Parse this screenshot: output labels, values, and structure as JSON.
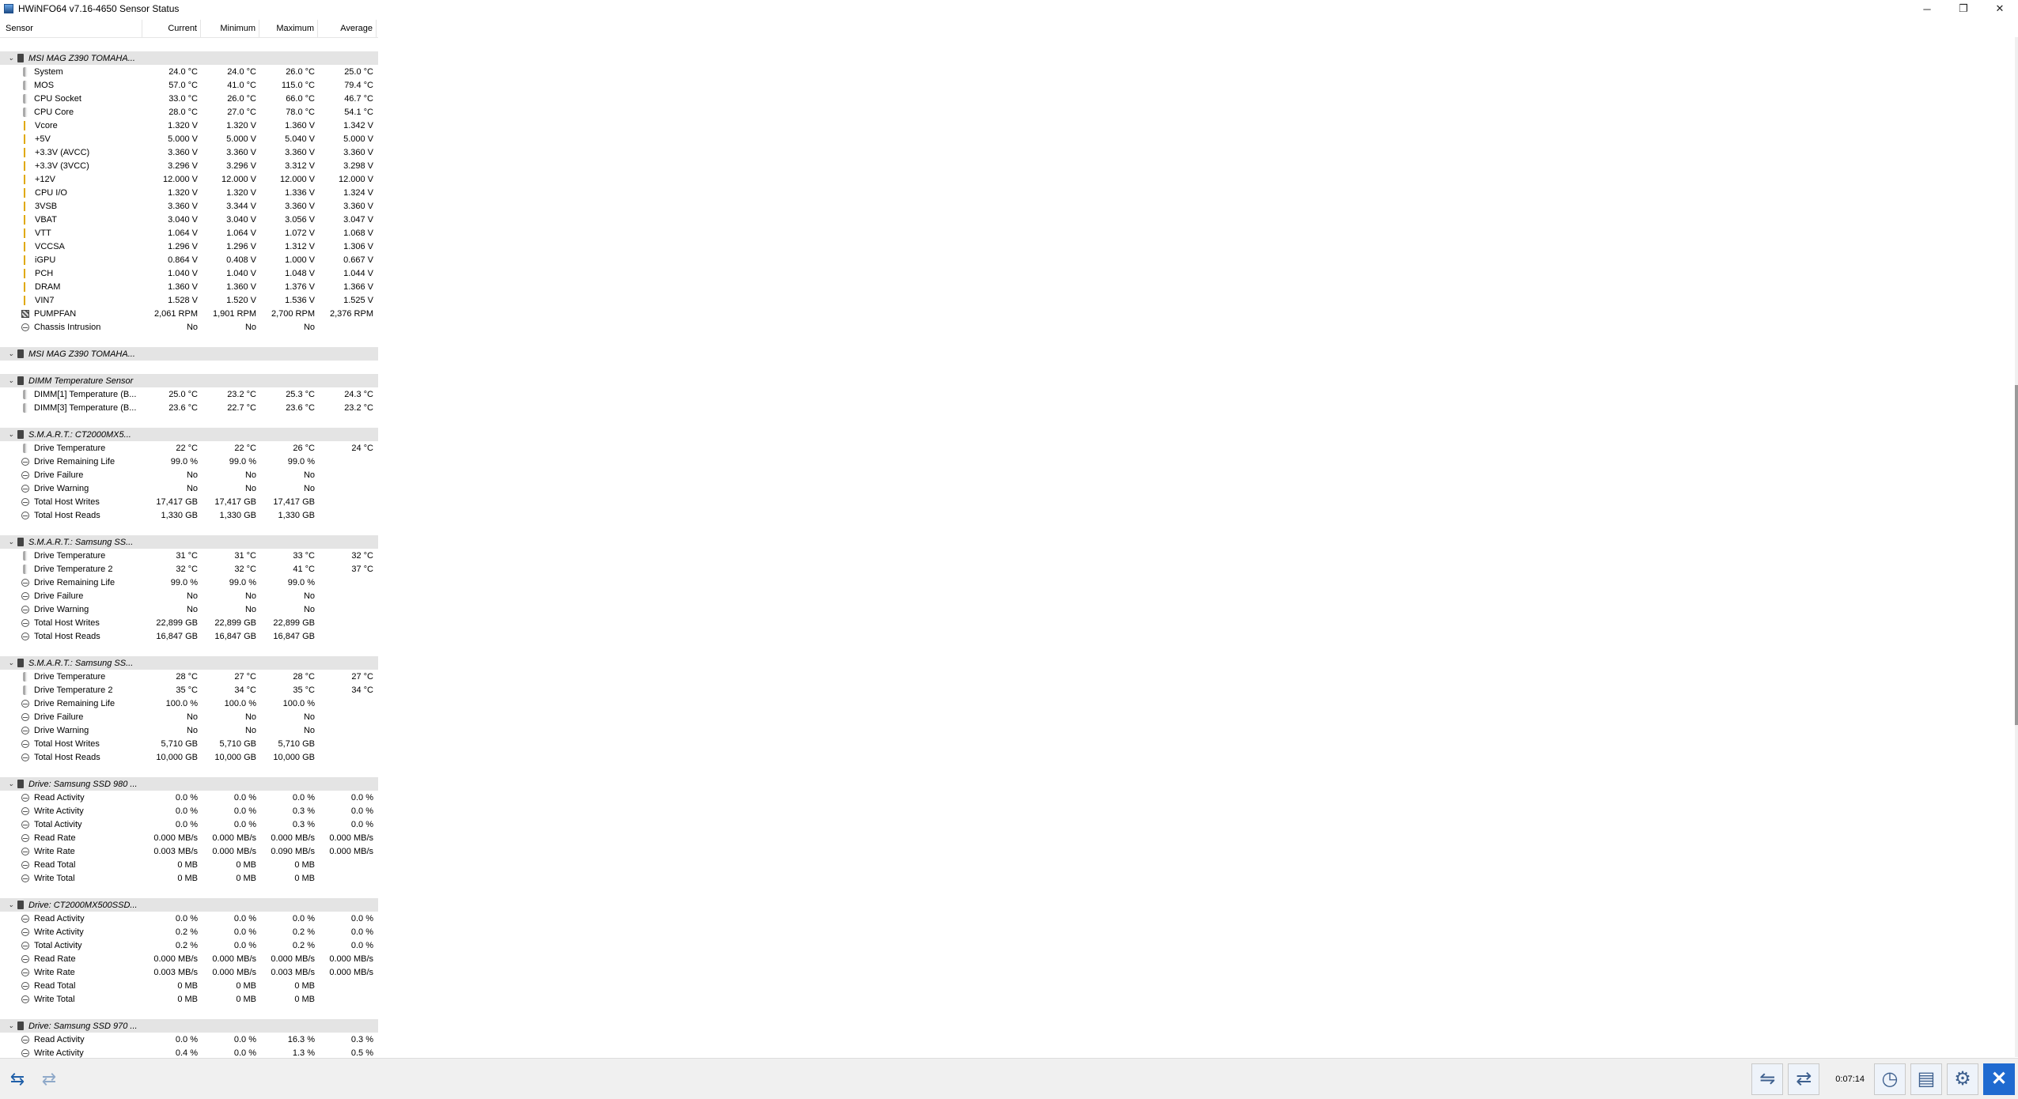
{
  "window": {
    "title": "HWiNFO64 v7.16-4650 Sensor Status",
    "minimize": "─",
    "maximize": "❐",
    "close": "✕"
  },
  "columns": [
    "Sensor",
    "Current",
    "Minimum",
    "Maximum",
    "Average"
  ],
  "rows": [
    {
      "type": "empty"
    },
    {
      "type": "group",
      "name": "MSI MAG Z390 TOMAHA..."
    },
    {
      "type": "sensor",
      "icon": "therm",
      "name": "System",
      "v": [
        "24.0 °C",
        "24.0 °C",
        "26.0 °C",
        "25.0 °C"
      ]
    },
    {
      "type": "sensor",
      "icon": "therm",
      "name": "MOS",
      "v": [
        "57.0 °C",
        "41.0 °C",
        "115.0 °C",
        "79.4 °C"
      ]
    },
    {
      "type": "sensor",
      "icon": "therm",
      "name": "CPU Socket",
      "v": [
        "33.0 °C",
        "26.0 °C",
        "66.0 °C",
        "46.7 °C"
      ]
    },
    {
      "type": "sensor",
      "icon": "therm",
      "name": "CPU Core",
      "v": [
        "28.0 °C",
        "27.0 °C",
        "78.0 °C",
        "54.1 °C"
      ]
    },
    {
      "type": "sensor",
      "icon": "volt",
      "name": "Vcore",
      "v": [
        "1.320 V",
        "1.320 V",
        "1.360 V",
        "1.342 V"
      ]
    },
    {
      "type": "sensor",
      "icon": "volt",
      "name": "+5V",
      "v": [
        "5.000 V",
        "5.000 V",
        "5.040 V",
        "5.000 V"
      ]
    },
    {
      "type": "sensor",
      "icon": "volt",
      "name": "+3.3V (AVCC)",
      "v": [
        "3.360 V",
        "3.360 V",
        "3.360 V",
        "3.360 V"
      ]
    },
    {
      "type": "sensor",
      "icon": "volt",
      "name": "+3.3V (3VCC)",
      "v": [
        "3.296 V",
        "3.296 V",
        "3.312 V",
        "3.298 V"
      ]
    },
    {
      "type": "sensor",
      "icon": "volt",
      "name": "+12V",
      "v": [
        "12.000 V",
        "12.000 V",
        "12.000 V",
        "12.000 V"
      ]
    },
    {
      "type": "sensor",
      "icon": "volt",
      "name": "CPU I/O",
      "v": [
        "1.320 V",
        "1.320 V",
        "1.336 V",
        "1.324 V"
      ]
    },
    {
      "type": "sensor",
      "icon": "volt",
      "name": "3VSB",
      "v": [
        "3.360 V",
        "3.344 V",
        "3.360 V",
        "3.360 V"
      ]
    },
    {
      "type": "sensor",
      "icon": "volt",
      "name": "VBAT",
      "v": [
        "3.040 V",
        "3.040 V",
        "3.056 V",
        "3.047 V"
      ]
    },
    {
      "type": "sensor",
      "icon": "volt",
      "name": "VTT",
      "v": [
        "1.064 V",
        "1.064 V",
        "1.072 V",
        "1.068 V"
      ]
    },
    {
      "type": "sensor",
      "icon": "volt",
      "name": "VCCSA",
      "v": [
        "1.296 V",
        "1.296 V",
        "1.312 V",
        "1.306 V"
      ]
    },
    {
      "type": "sensor",
      "icon": "volt",
      "name": "iGPU",
      "v": [
        "0.864 V",
        "0.408 V",
        "1.000 V",
        "0.667 V"
      ]
    },
    {
      "type": "sensor",
      "icon": "volt",
      "name": "PCH",
      "v": [
        "1.040 V",
        "1.040 V",
        "1.048 V",
        "1.044 V"
      ]
    },
    {
      "type": "sensor",
      "icon": "volt",
      "name": "DRAM",
      "v": [
        "1.360 V",
        "1.360 V",
        "1.376 V",
        "1.366 V"
      ]
    },
    {
      "type": "sensor",
      "icon": "volt",
      "name": "VIN7",
      "v": [
        "1.528 V",
        "1.520 V",
        "1.536 V",
        "1.525 V"
      ]
    },
    {
      "type": "sensor",
      "icon": "fan",
      "name": "PUMPFAN",
      "v": [
        "2,061 RPM",
        "1,901 RPM",
        "2,700 RPM",
        "2,376 RPM"
      ]
    },
    {
      "type": "sensor",
      "icon": "other",
      "name": "Chassis Intrusion",
      "v": [
        "No",
        "No",
        "No",
        ""
      ]
    },
    {
      "type": "empty"
    },
    {
      "type": "group",
      "name": "MSI MAG Z390 TOMAHA..."
    },
    {
      "type": "empty"
    },
    {
      "type": "group",
      "name": "DIMM Temperature Sensor"
    },
    {
      "type": "sensor",
      "icon": "therm",
      "name": "DIMM[1] Temperature (B...",
      "v": [
        "25.0 °C",
        "23.2 °C",
        "25.3 °C",
        "24.3 °C"
      ]
    },
    {
      "type": "sensor",
      "icon": "therm",
      "name": "DIMM[3] Temperature (B...",
      "v": [
        "23.6 °C",
        "22.7 °C",
        "23.6 °C",
        "23.2 °C"
      ]
    },
    {
      "type": "empty"
    },
    {
      "type": "group",
      "name": "S.M.A.R.T.: CT2000MX5..."
    },
    {
      "type": "sensor",
      "icon": "therm",
      "name": "Drive Temperature",
      "v": [
        "22 °C",
        "22 °C",
        "26 °C",
        "24 °C"
      ]
    },
    {
      "type": "sensor",
      "icon": "other",
      "name": "Drive Remaining Life",
      "v": [
        "99.0 %",
        "99.0 %",
        "99.0 %",
        ""
      ]
    },
    {
      "type": "sensor",
      "icon": "other",
      "name": "Drive Failure",
      "v": [
        "No",
        "No",
        "No",
        ""
      ]
    },
    {
      "type": "sensor",
      "icon": "other",
      "name": "Drive Warning",
      "v": [
        "No",
        "No",
        "No",
        ""
      ]
    },
    {
      "type": "sensor",
      "icon": "other",
      "name": "Total Host Writes",
      "v": [
        "17,417 GB",
        "17,417 GB",
        "17,417 GB",
        ""
      ]
    },
    {
      "type": "sensor",
      "icon": "other",
      "name": "Total Host Reads",
      "v": [
        "1,330 GB",
        "1,330 GB",
        "1,330 GB",
        ""
      ]
    },
    {
      "type": "empty"
    },
    {
      "type": "group",
      "name": "S.M.A.R.T.: Samsung SS..."
    },
    {
      "type": "sensor",
      "icon": "therm",
      "name": "Drive Temperature",
      "v": [
        "31 °C",
        "31 °C",
        "33 °C",
        "32 °C"
      ]
    },
    {
      "type": "sensor",
      "icon": "therm",
      "name": "Drive Temperature 2",
      "v": [
        "32 °C",
        "32 °C",
        "41 °C",
        "37 °C"
      ]
    },
    {
      "type": "sensor",
      "icon": "other",
      "name": "Drive Remaining Life",
      "v": [
        "99.0 %",
        "99.0 %",
        "99.0 %",
        ""
      ]
    },
    {
      "type": "sensor",
      "icon": "other",
      "name": "Drive Failure",
      "v": [
        "No",
        "No",
        "No",
        ""
      ]
    },
    {
      "type": "sensor",
      "icon": "other",
      "name": "Drive Warning",
      "v": [
        "No",
        "No",
        "No",
        ""
      ]
    },
    {
      "type": "sensor",
      "icon": "other",
      "name": "Total Host Writes",
      "v": [
        "22,899 GB",
        "22,899 GB",
        "22,899 GB",
        ""
      ]
    },
    {
      "type": "sensor",
      "icon": "other",
      "name": "Total Host Reads",
      "v": [
        "16,847 GB",
        "16,847 GB",
        "16,847 GB",
        ""
      ]
    },
    {
      "type": "empty"
    },
    {
      "type": "group",
      "name": "S.M.A.R.T.: Samsung SS..."
    },
    {
      "type": "sensor",
      "icon": "therm",
      "name": "Drive Temperature",
      "v": [
        "28 °C",
        "27 °C",
        "28 °C",
        "27 °C"
      ]
    },
    {
      "type": "sensor",
      "icon": "therm",
      "name": "Drive Temperature 2",
      "v": [
        "35 °C",
        "34 °C",
        "35 °C",
        "34 °C"
      ]
    },
    {
      "type": "sensor",
      "icon": "other",
      "name": "Drive Remaining Life",
      "v": [
        "100.0 %",
        "100.0 %",
        "100.0 %",
        ""
      ]
    },
    {
      "type": "sensor",
      "icon": "other",
      "name": "Drive Failure",
      "v": [
        "No",
        "No",
        "No",
        ""
      ]
    },
    {
      "type": "sensor",
      "icon": "other",
      "name": "Drive Warning",
      "v": [
        "No",
        "No",
        "No",
        ""
      ]
    },
    {
      "type": "sensor",
      "icon": "other",
      "name": "Total Host Writes",
      "v": [
        "5,710 GB",
        "5,710 GB",
        "5,710 GB",
        ""
      ]
    },
    {
      "type": "sensor",
      "icon": "other",
      "name": "Total Host Reads",
      "v": [
        "10,000 GB",
        "10,000 GB",
        "10,000 GB",
        ""
      ]
    },
    {
      "type": "empty"
    },
    {
      "type": "group",
      "name": "Drive: Samsung SSD 980 ..."
    },
    {
      "type": "sensor",
      "icon": "other",
      "name": "Read Activity",
      "v": [
        "0.0 %",
        "0.0 %",
        "0.0 %",
        "0.0 %"
      ]
    },
    {
      "type": "sensor",
      "icon": "other",
      "name": "Write Activity",
      "v": [
        "0.0 %",
        "0.0 %",
        "0.3 %",
        "0.0 %"
      ]
    },
    {
      "type": "sensor",
      "icon": "other",
      "name": "Total Activity",
      "v": [
        "0.0 %",
        "0.0 %",
        "0.3 %",
        "0.0 %"
      ]
    },
    {
      "type": "sensor",
      "icon": "other",
      "name": "Read Rate",
      "v": [
        "0.000 MB/s",
        "0.000 MB/s",
        "0.000 MB/s",
        "0.000 MB/s"
      ]
    },
    {
      "type": "sensor",
      "icon": "other",
      "name": "Write Rate",
      "v": [
        "0.003 MB/s",
        "0.000 MB/s",
        "0.090 MB/s",
        "0.000 MB/s"
      ]
    },
    {
      "type": "sensor",
      "icon": "other",
      "name": "Read Total",
      "v": [
        "0 MB",
        "0 MB",
        "0 MB",
        ""
      ]
    },
    {
      "type": "sensor",
      "icon": "other",
      "name": "Write Total",
      "v": [
        "0 MB",
        "0 MB",
        "0 MB",
        ""
      ]
    },
    {
      "type": "empty"
    },
    {
      "type": "group",
      "name": "Drive: CT2000MX500SSD..."
    },
    {
      "type": "sensor",
      "icon": "other",
      "name": "Read Activity",
      "v": [
        "0.0 %",
        "0.0 %",
        "0.0 %",
        "0.0 %"
      ]
    },
    {
      "type": "sensor",
      "icon": "other",
      "name": "Write Activity",
      "v": [
        "0.2 %",
        "0.0 %",
        "0.2 %",
        "0.0 %"
      ]
    },
    {
      "type": "sensor",
      "icon": "other",
      "name": "Total Activity",
      "v": [
        "0.2 %",
        "0.0 %",
        "0.2 %",
        "0.0 %"
      ]
    },
    {
      "type": "sensor",
      "icon": "other",
      "name": "Read Rate",
      "v": [
        "0.000 MB/s",
        "0.000 MB/s",
        "0.000 MB/s",
        "0.000 MB/s"
      ]
    },
    {
      "type": "sensor",
      "icon": "other",
      "name": "Write Rate",
      "v": [
        "0.003 MB/s",
        "0.000 MB/s",
        "0.003 MB/s",
        "0.000 MB/s"
      ]
    },
    {
      "type": "sensor",
      "icon": "other",
      "name": "Read Total",
      "v": [
        "0 MB",
        "0 MB",
        "0 MB",
        ""
      ]
    },
    {
      "type": "sensor",
      "icon": "other",
      "name": "Write Total",
      "v": [
        "0 MB",
        "0 MB",
        "0 MB",
        ""
      ]
    },
    {
      "type": "empty"
    },
    {
      "type": "group",
      "name": "Drive: Samsung SSD 970 ..."
    },
    {
      "type": "sensor",
      "icon": "other",
      "name": "Read Activity",
      "v": [
        "0.0 %",
        "0.0 %",
        "16.3 %",
        "0.3 %"
      ]
    },
    {
      "type": "sensor",
      "icon": "other",
      "name": "Write Activity",
      "v": [
        "0.4 %",
        "0.0 %",
        "1.3 %",
        "0.5 %"
      ]
    }
  ],
  "toolbar": {
    "nav_left": "⇆",
    "nav_right": "⇄",
    "elapsed": "0:07:14",
    "icons": [
      "network-icon",
      "swap-icon",
      "clock-icon",
      "add-report-icon",
      "settings-icon",
      "close-icon"
    ]
  }
}
